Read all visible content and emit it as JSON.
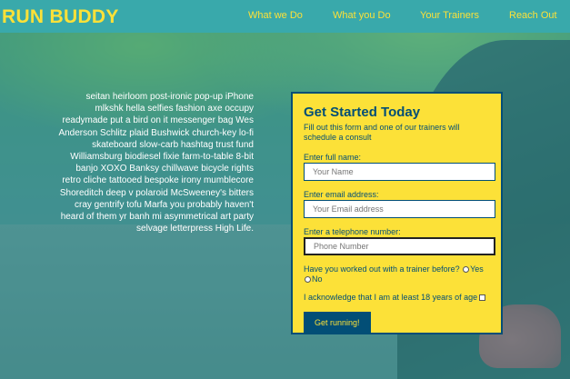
{
  "header": {
    "logo": "RUN BUDDY",
    "nav": [
      "What we Do",
      "What you Do",
      "Your Trainers",
      "Reach Out"
    ]
  },
  "hero": {
    "paragraph": "seitan heirloom post-ironic pop-up iPhone mlkshk hella selfies fashion axe occupy readymade put a bird on it messenger bag Wes Anderson Schlitz plaid Bushwick church-key lo-fi skateboard slow-carb hashtag trust fund Williamsburg biodiesel fixie farm-to-table 8-bit banjo XOXO Banksy chillwave bicycle rights retro cliche tattooed bespoke irony mumblecore Shoreditch deep v polaroid McSweeney's bitters cray gentrify tofu Marfa you probably haven't heard of them yr banh mi asymmetrical art party selvage letterpress High Life."
  },
  "form": {
    "title": "Get Started Today",
    "subtitle": "Fill out this form and one of our trainers will schedule a consult",
    "name_label": "Enter full name:",
    "name_placeholder": "Your Name",
    "email_label": "Enter email address:",
    "email_placeholder": "Your Email address",
    "phone_label": "Enter a telephone number:",
    "phone_placeholder": "Phone Number",
    "trainer_question": "Have you worked out with a trainer before?",
    "yes_label": "Yes",
    "no_label": "No",
    "ack_label": "I acknowledge that I am at least 18 years of age",
    "submit_label": "Get running!"
  },
  "colors": {
    "header_bg": "#39a9ab",
    "accent_yellow": "#fce138",
    "navy": "#024e76"
  }
}
